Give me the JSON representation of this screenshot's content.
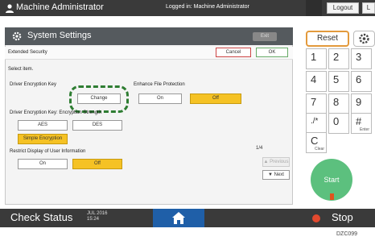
{
  "header": {
    "user_label": "Machine Administrator",
    "logged_in_text": "Logged in: Machine Administrator",
    "logout_label": "Logout",
    "kbd_label": "L"
  },
  "panel": {
    "title": "System Settings",
    "exit_label": "Exit",
    "subtitle": "Extended Security",
    "cancel_label": "Cancel",
    "ok_label": "OK",
    "instruction": "Select item.",
    "settings": [
      {
        "label": "Driver Encryption Key",
        "options": [
          "Change"
        ],
        "selected": -1
      },
      {
        "label": "Enhance File Protection",
        "options": [
          "On",
          "Off"
        ],
        "selected": 1
      },
      {
        "label": "Driver Encryption Key: Encryption Strength",
        "options": [
          "AES",
          "DES"
        ],
        "selected": -1
      },
      {
        "label": "",
        "options": [
          "Simple Encryption"
        ],
        "selected": 0
      },
      {
        "label": "Restrict Display of User Information",
        "options": [
          "On",
          "Off"
        ],
        "selected": 1
      }
    ],
    "page_indicator": "1/4",
    "prev_label": "▲ Previous",
    "next_label": "▼ Next"
  },
  "keypad": {
    "reset_label": "Reset",
    "keys": [
      {
        "main": "1",
        "sub": ""
      },
      {
        "main": "2",
        "sub": ""
      },
      {
        "main": "3",
        "sub": ""
      },
      {
        "main": "4",
        "sub": ""
      },
      {
        "main": "5",
        "sub": ""
      },
      {
        "main": "6",
        "sub": ""
      },
      {
        "main": "7",
        "sub": ""
      },
      {
        "main": "8",
        "sub": ""
      },
      {
        "main": "9",
        "sub": ""
      },
      {
        "main": "./*",
        "sub": ""
      },
      {
        "main": "0",
        "sub": ""
      },
      {
        "main": "#",
        "sub": "Enter"
      },
      {
        "main": "C",
        "sub": "Clear"
      }
    ],
    "start_label": "Start"
  },
  "footer": {
    "check_status": "Check Status",
    "date": "JUL 2016",
    "time": "15:24",
    "stop_label": "Stop",
    "figure_code": "DZC099"
  },
  "colors": {
    "selected": "#f5c224",
    "highlight": "#2e7d32",
    "start": "#5cc07e",
    "reset_border": "#e39a3c",
    "home": "#1f5fa8"
  }
}
